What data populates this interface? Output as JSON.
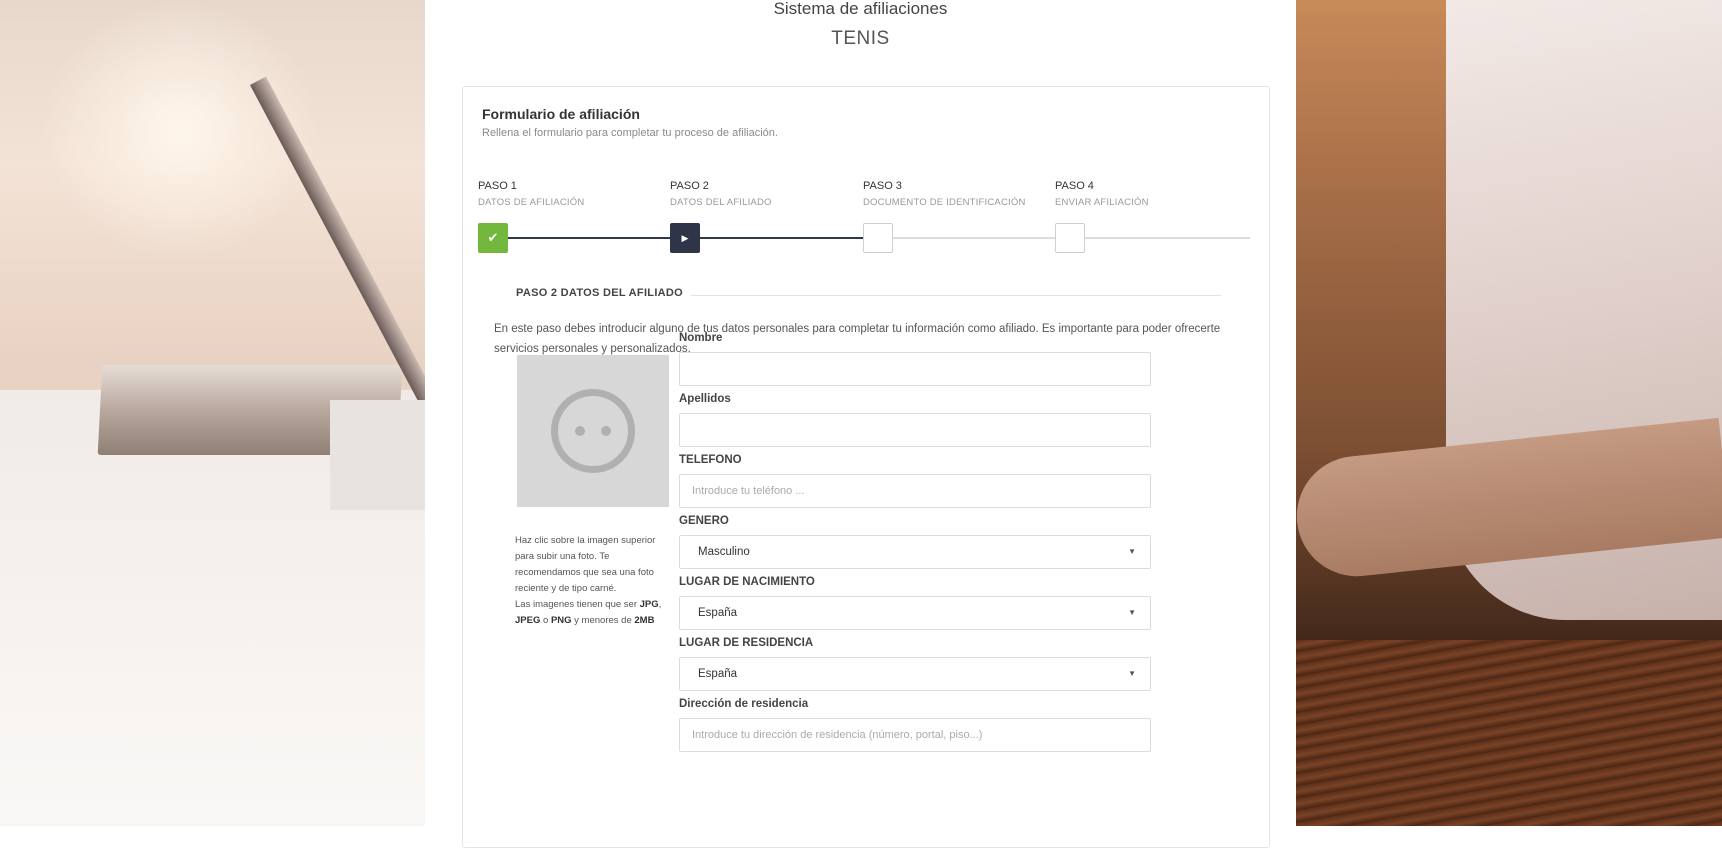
{
  "app": {
    "title": "Sistema de afiliaciones",
    "subtitle": "TENIS"
  },
  "form": {
    "title": "Formulario de afiliación",
    "subtitle": "Rellena el formulario para completar tu proceso de afiliación."
  },
  "steps": [
    {
      "number": "PASO 1",
      "name": "DATOS DE AFILIACIÓN",
      "state": "done",
      "icon": "check-icon"
    },
    {
      "number": "PASO 2",
      "name": "DATOS DEL AFILIADO",
      "state": "active",
      "icon": "play-icon"
    },
    {
      "number": "PASO 3",
      "name": "DOCUMENTO DE IDENTIFICACIÓN",
      "state": "todo"
    },
    {
      "number": "PASO 4",
      "name": "ENVIAR AFILIACIÓN",
      "state": "todo"
    }
  ],
  "section": {
    "heading": "PASO 2 DATOS DEL AFILIADO",
    "intro": "En este paso debes introducir alguno de tus datos personales para completar tu información como afiliado. Es importante para poder ofrecerte servicios personales y personalizados."
  },
  "photo": {
    "help_line1": "Haz clic sobre la imagen superior para subir una foto. Te recomendamos que sea una foto reciente y de tipo carné.",
    "help_line2_pre": "Las imagenes tienen que ser",
    "fmt1": "JPG",
    "sep1": ",",
    "fmt2": "JPEG",
    "sep2": "o",
    "fmt3": "PNG",
    "help_line2_mid": "y menores de",
    "size": "2MB"
  },
  "fields": {
    "nombre": {
      "label": "Nombre",
      "value": "",
      "placeholder": ""
    },
    "apellidos": {
      "label": "Apellidos",
      "value": "",
      "placeholder": ""
    },
    "telefono": {
      "label": "TELEFONO",
      "value": "",
      "placeholder": "Introduce tu teléfono ..."
    },
    "genero": {
      "label": "GENERO",
      "value": "Masculino"
    },
    "lugar_nacimiento": {
      "label": "LUGAR DE NACIMIENTO",
      "value": "España"
    },
    "lugar_residencia": {
      "label": "LUGAR DE RESIDENCIA",
      "value": "España"
    },
    "direccion": {
      "label": "Dirección de residencia",
      "value": "",
      "placeholder": "Introduce tu dirección de residencia (número, portal, piso...)"
    }
  },
  "colors": {
    "step_done": "#74b73e",
    "step_active": "#2e3548",
    "step_todo_border": "#cfcfcf"
  }
}
